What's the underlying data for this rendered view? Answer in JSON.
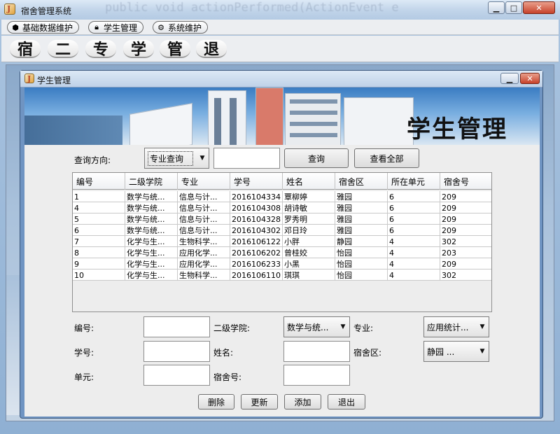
{
  "window": {
    "title": "宿舍管理系统"
  },
  "menu": [
    {
      "label": "基础数据维护",
      "icon": "cube-icon"
    },
    {
      "label": "学生管理",
      "icon": "lock-icon"
    },
    {
      "label": "系统维护",
      "icon": "gear-icon"
    }
  ],
  "toolbar": [
    "宿",
    "二",
    "专",
    "学",
    "管",
    "退"
  ],
  "internal_frame": {
    "title": "学生管理",
    "banner_title": "学生管理"
  },
  "query": {
    "label": "查询方向:",
    "direction": "专业查询",
    "value": "",
    "search_button": "查询",
    "show_all_button": "查看全部"
  },
  "table": {
    "columns": [
      "编号",
      "二级学院",
      "专业",
      "学号",
      "姓名",
      "宿舍区",
      "所在单元",
      "宿舍号"
    ],
    "rows": [
      [
        "1",
        "数学与统...",
        "信息与计...",
        "2016104334",
        "覃柳婷",
        "雅园",
        "6",
        "209"
      ],
      [
        "4",
        "数学与统...",
        "信息与计...",
        "2016104308",
        "胡诗敏",
        "雅园",
        "6",
        "209"
      ],
      [
        "5",
        "数学与统...",
        "信息与计...",
        "2016104328",
        "罗秀明",
        "雅园",
        "6",
        "209"
      ],
      [
        "6",
        "数学与统...",
        "信息与计...",
        "2016104302",
        "邓日玲",
        "雅园",
        "6",
        "209"
      ],
      [
        "7",
        "化学与生...",
        "生物科学...",
        "2016106122",
        "小胖",
        "静园",
        "4",
        "302"
      ],
      [
        "8",
        "化学与生...",
        "应用化学...",
        "2016106202",
        "曾桂姣",
        "怡园",
        "4",
        "203"
      ],
      [
        "9",
        "化学与生...",
        "应用化学...",
        "2016106233",
        "小黑",
        "怡园",
        "4",
        "209"
      ],
      [
        "10",
        "化学与生...",
        "生物科学...",
        "2016106110",
        "琪琪",
        "怡园",
        "4",
        "302"
      ]
    ]
  },
  "form": {
    "id_label": "编号:",
    "id_value": "",
    "college_label": "二级学院:",
    "college_value": "数学与统...",
    "major_label": "专业:",
    "major_value": "应用统计...",
    "student_no_label": "学号:",
    "student_no_value": "",
    "name_label": "姓名:",
    "name_value": "",
    "dorm_area_label": "宿舍区:",
    "dorm_area_value": "静园 ...",
    "unit_label": "单元:",
    "unit_value": "",
    "room_label": "宿舍号:",
    "room_value": ""
  },
  "actions": {
    "delete": "删除",
    "update": "更新",
    "add": "添加",
    "exit": "退出"
  },
  "background_text": "public void actionPerformed(ActionEvent e"
}
